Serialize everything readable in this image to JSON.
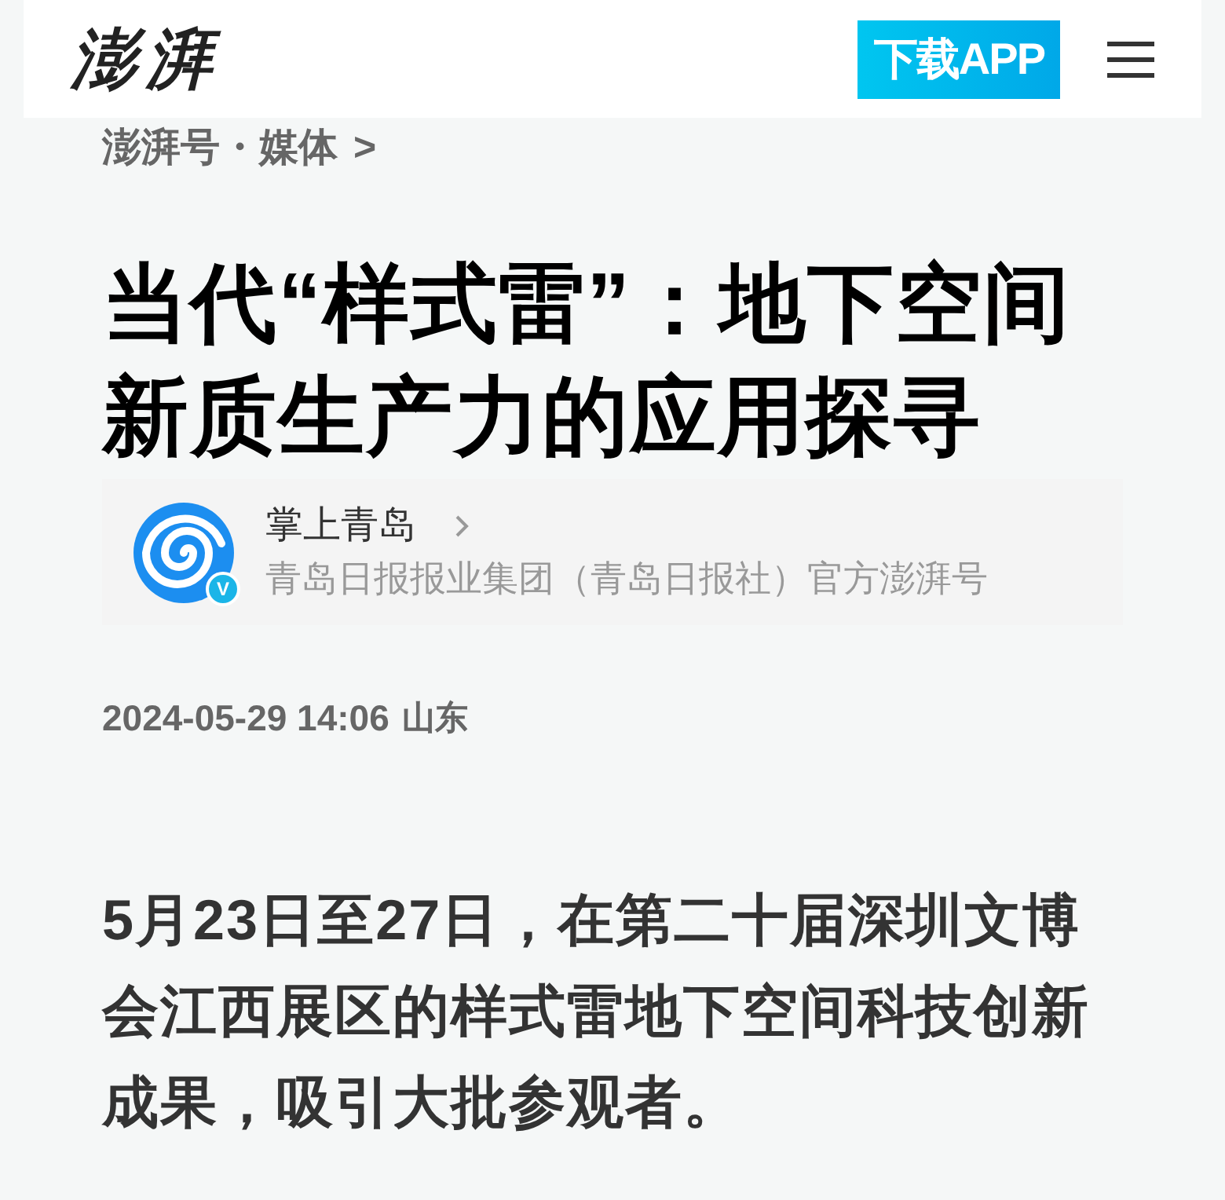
{
  "header": {
    "logo": "澎湃",
    "download_button": "下载APP"
  },
  "breadcrumb": {
    "text": "澎湃号・媒体",
    "arrow": ">"
  },
  "article": {
    "title": "当代“样式雷”：地下空间新质生产力的应用探寻",
    "author": {
      "name": "掌上青岛",
      "verified_badge": "V",
      "description": "青岛日报报业集团（青岛日报社）官方澎湃号"
    },
    "meta": {
      "datetime": "2024-05-29 14:06",
      "location": "山东"
    },
    "paragraph": "5月23日至27日，在第二十届深圳文博会江西展区的样式雷地下空间科技创新成果，吸引大批参观者。"
  }
}
